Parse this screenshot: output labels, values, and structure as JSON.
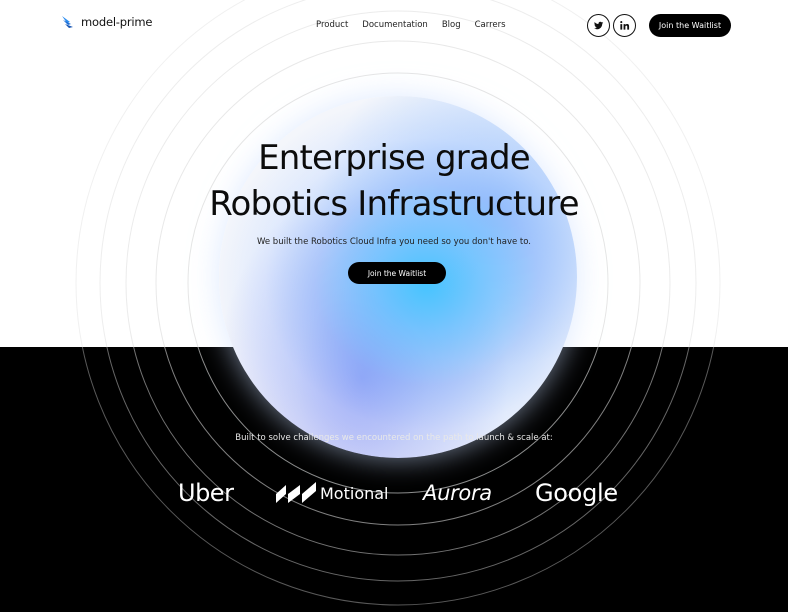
{
  "brand": {
    "name": "model-prime",
    "logo_icon": "wing-icon"
  },
  "nav": {
    "items": [
      {
        "label": "Product"
      },
      {
        "label": "Documentation"
      },
      {
        "label": "Blog"
      },
      {
        "label": "Carrers"
      }
    ]
  },
  "social": {
    "twitter_icon": "twitter-icon",
    "linkedin_icon": "linkedin-icon"
  },
  "header_cta": {
    "label": "Join the Waitlist"
  },
  "hero": {
    "headline_line1": "Enterprise grade",
    "headline_line2": "Robotics Infrastructure",
    "subheadline": "We built the Robotics Cloud Infra you need so you don't have to.",
    "cta_label": "Join the Waitlist"
  },
  "customers": {
    "tagline": "Built to solve challenges we encountered on the path to launch & scale at:",
    "logos": [
      {
        "name": "Uber"
      },
      {
        "name": "Motional"
      },
      {
        "name": "Aurora"
      },
      {
        "name": "Google"
      }
    ]
  },
  "colors": {
    "accent_blue": "#40c4ff",
    "background_top": "#ffffff",
    "background_bottom": "#000000",
    "button": "#000000"
  }
}
